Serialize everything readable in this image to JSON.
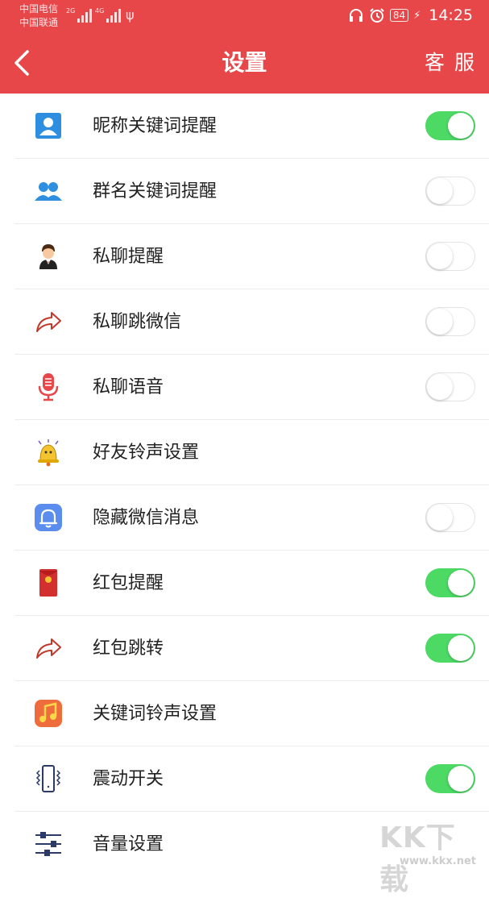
{
  "status_bar": {
    "carrier1": "中国电信",
    "carrier2": "中国联通",
    "sim1_network": "2G",
    "sim2_network": "4G",
    "battery": "84",
    "time": "14:25"
  },
  "header": {
    "back_icon": "chevron-left-icon",
    "title": "设置",
    "service_label": "客 服",
    "background_color": "#e8474a"
  },
  "settings": [
    {
      "label": "昵称关键词提醒",
      "icon": "user-card-icon",
      "toggle": true,
      "on": true
    },
    {
      "label": "群名关键词提醒",
      "icon": "group-users-icon",
      "toggle": true,
      "on": false
    },
    {
      "label": "私聊提醒",
      "icon": "butler-avatar-icon",
      "toggle": true,
      "on": false
    },
    {
      "label": "私聊跳微信",
      "icon": "share-arrow-icon",
      "toggle": true,
      "on": false
    },
    {
      "label": "私聊语音",
      "icon": "microphone-icon",
      "toggle": true,
      "on": false
    },
    {
      "label": "好友铃声设置",
      "icon": "bell-cartoon-icon",
      "toggle": false
    },
    {
      "label": "隐藏微信消息",
      "icon": "bell-tile-icon",
      "toggle": true,
      "on": false
    },
    {
      "label": "红包提醒",
      "icon": "red-packet-icon",
      "toggle": true,
      "on": true
    },
    {
      "label": "红包跳转",
      "icon": "share-arrow-icon",
      "toggle": true,
      "on": true
    },
    {
      "label": "关键词铃声设置",
      "icon": "music-note-icon",
      "toggle": false
    },
    {
      "label": "震动开关",
      "icon": "phone-vibrate-icon",
      "toggle": true,
      "on": true
    },
    {
      "label": "音量设置",
      "icon": "equalizer-sliders-icon",
      "toggle": false
    }
  ],
  "watermark": {
    "main": "KK下载",
    "sub": "www.kkx.net"
  },
  "colors": {
    "toggle_on": "#4cd964",
    "accent_red": "#e8474a"
  }
}
